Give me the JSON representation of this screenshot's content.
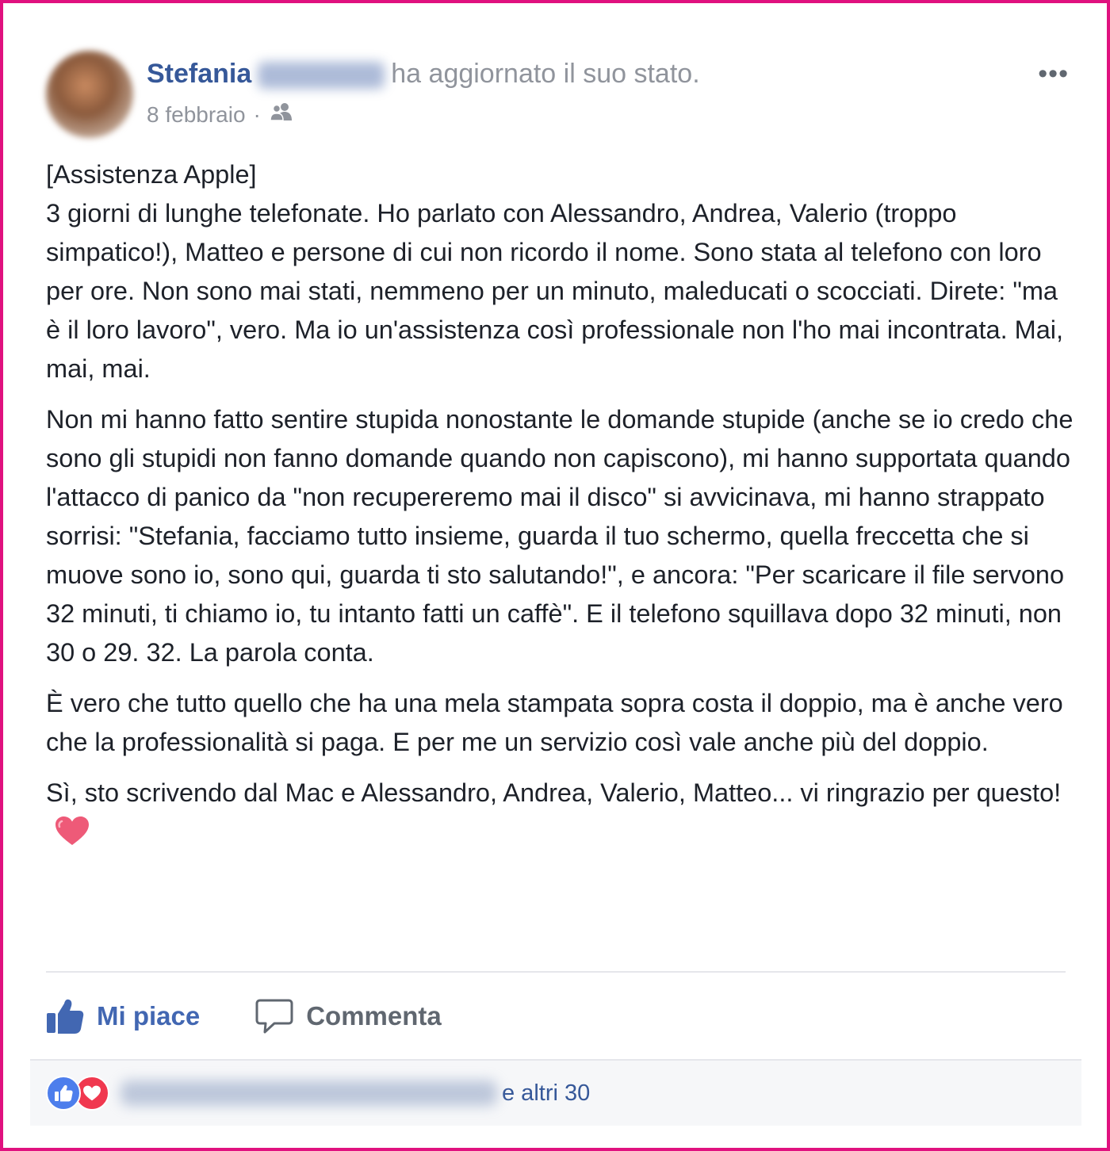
{
  "post": {
    "author": "Stefania",
    "action": "ha aggiornato il suo stato.",
    "date": "8 febbraio",
    "separator": "·",
    "audience_icon": "friends-icon",
    "more_label": "•••",
    "paragraphs": [
      "[Assistenza Apple]\n3 giorni di lunghe telefonate. Ho parlato con Alessandro, Andrea, Valerio (troppo simpatico!), Matteo e persone di cui non ricordo il nome. Sono stata al telefono con loro per ore. Non sono mai stati, nemmeno per un minuto, maleducati o scocciati. Direte: \"ma è il loro lavoro\", vero. Ma io un'assistenza così professionale non l'ho mai incontrata. Mai, mai, mai.",
      "Non mi hanno fatto sentire stupida nonostante le domande stupide (anche se io credo che sono gli stupidi non fanno domande quando non capiscono), mi hanno supportata quando l'attacco di panico da \"non recupereremo mai il disco\" si avvicinava, mi hanno strappato sorrisi: \"Stefania, facciamo tutto insieme, guarda il tuo schermo, quella freccetta che si muove sono io, sono qui, guarda ti sto salutando!\", e ancora: \"Per scaricare il file servono 32 minuti, ti chiamo io, tu intanto fatti un caffè\". E il telefono squillava dopo 32 minuti, non 30 o 29. 32. La parola conta.",
      "È vero che tutto quello che ha una mela stampata sopra costa il doppio, ma è anche vero che la professionalità si paga. E per me un servizio così vale anche più del doppio.",
      "Sì, sto scrivendo dal Mac e Alessandro, Andrea, Valerio, Matteo... vi ringrazio per questo!"
    ]
  },
  "actions": {
    "like": "Mi piace",
    "comment": "Commenta"
  },
  "reactions": {
    "others": "e altri 30",
    "icons": [
      "like-icon",
      "love-icon"
    ]
  },
  "colors": {
    "link": "#365899",
    "like": "#4267b2",
    "frame": "#e0117f",
    "love": "#f0384f"
  }
}
